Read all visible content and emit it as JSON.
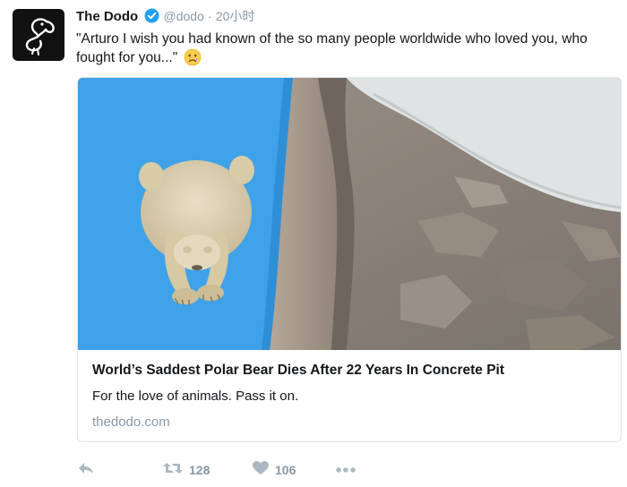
{
  "tweet": {
    "author_name": "The Dodo",
    "handle": "@dodo",
    "separator": "·",
    "time": "20小时",
    "text": "\"Arturo I wish you had known of the so many people worldwide who loved you, who fought for you...\"",
    "emoji": "crying-face-emoji"
  },
  "card": {
    "title": "World’s Saddest Polar Bear Dies After 22 Years In Concrete Pit",
    "description": "For the love of animals. Pass it on.",
    "domain": "thedodo.com"
  },
  "actions": {
    "reply_icon": "reply-icon",
    "retweet_icon": "retweet-icon",
    "retweet_count": "128",
    "like_icon": "heart-icon",
    "like_count": "106",
    "more_icon": "more-dots-icon"
  },
  "colors": {
    "pool_blue": "#3fa2e8",
    "verified_blue": "#1da1f2",
    "muted_text": "#8899a6",
    "action_icon": "#aab8c2"
  }
}
